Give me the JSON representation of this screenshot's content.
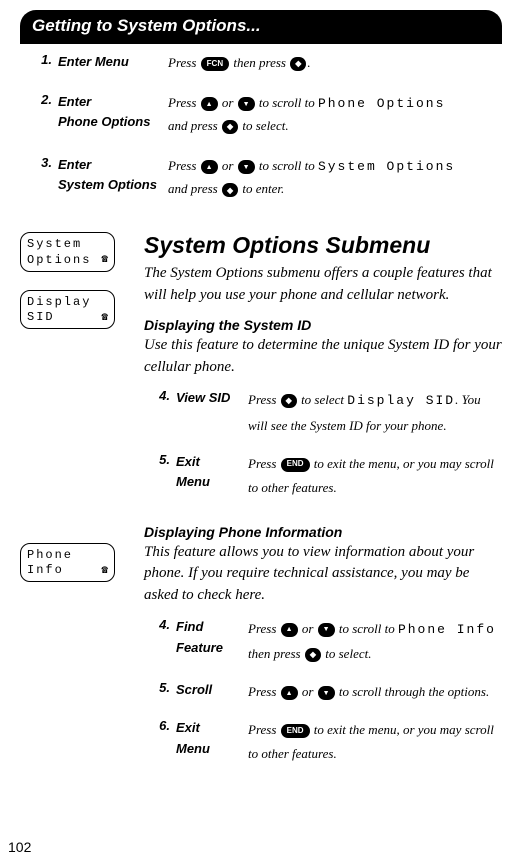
{
  "header": {
    "title": "Getting to System Options..."
  },
  "top_steps": [
    {
      "num": "1.",
      "label": "Enter Menu",
      "desc_a": "Press ",
      "key1": "FCN",
      "desc_b": " then press ",
      "key2": "diamond",
      "desc_c": "."
    },
    {
      "num": "2.",
      "label_line1": "Enter",
      "label_line2": "Phone Options",
      "desc_a": "Press ",
      "desc_b": " or ",
      "desc_c": " to scroll to ",
      "lcd": "Phone Options",
      "desc_d": "and press ",
      "desc_e": " to select."
    },
    {
      "num": "3.",
      "label_line1": "Enter",
      "label_line2": "System Options",
      "desc_a": "Press ",
      "desc_b": " or ",
      "desc_c": " to scroll to ",
      "lcd": "System Options",
      "desc_d": "and press ",
      "desc_e": " to enter."
    }
  ],
  "lcd_boxes": {
    "box1_l1": "System",
    "box1_l2": "Options",
    "box2_l1": "Display",
    "box2_l2": "SID",
    "box3_l1": "Phone",
    "box3_l2": "Info"
  },
  "main": {
    "h1": "System Options Submenu",
    "intro": "The System Options submenu offers a couple features that will help you use your phone and cellular network.",
    "sec1_h": "Displaying the System ID",
    "sec1_p": "Use this feature to determine the unique System ID for your cellular phone.",
    "sec1_steps": [
      {
        "num": "4.",
        "label": "View SID",
        "d1": "Press ",
        "d2": " to select ",
        "lcd": "Display SID",
        "d3": ". You will see the System ID for your phone."
      },
      {
        "num": "5.",
        "label_l1": "Exit",
        "label_l2": "Menu",
        "d1": "Press ",
        "key": "END",
        "d2": " to exit the menu, or you may scroll to other features."
      }
    ],
    "sec2_h": "Displaying Phone Information",
    "sec2_p": "This feature allows you to view information about your phone. If you require technical assistance, you may be asked to check here.",
    "sec2_steps": [
      {
        "num": "4.",
        "label_l1": "Find",
        "label_l2": "Feature",
        "d1": "Press ",
        "d2": " or ",
        "d3": " to scroll to ",
        "lcd": "Phone Info",
        "d4": " then press ",
        "d5": " to select."
      },
      {
        "num": "5.",
        "label": "Scroll",
        "d1": "Press ",
        "d2": " or ",
        "d3": " to scroll through the options."
      },
      {
        "num": "6.",
        "label_l1": "Exit",
        "label_l2": "Menu",
        "d1": "Press ",
        "key": "END",
        "d2": " to exit the menu, or you may scroll to other features."
      }
    ]
  },
  "page": "102"
}
